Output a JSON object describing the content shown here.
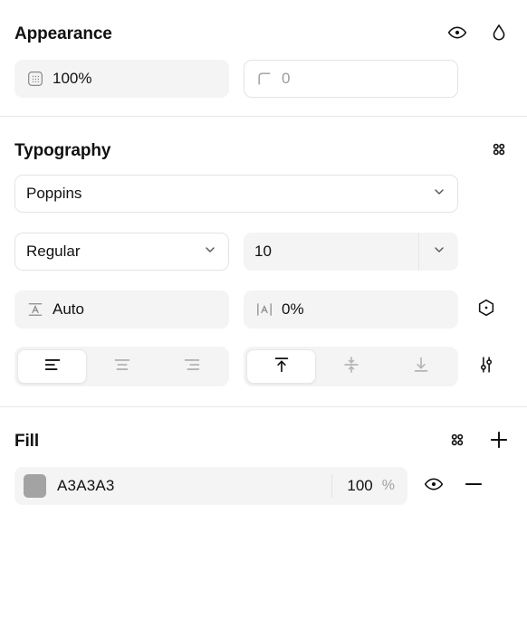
{
  "appearance": {
    "title": "Appearance",
    "actions": [
      {
        "name": "visibility-toggle",
        "icon": "eye-icon"
      },
      {
        "name": "blend-mode",
        "icon": "droplet-icon"
      }
    ],
    "opacity": {
      "icon": "opacity-grid-icon",
      "value": "100%"
    },
    "corner_radius": {
      "icon": "corner-radius-icon",
      "value": "0"
    }
  },
  "typography": {
    "title": "Typography",
    "actions": [
      {
        "name": "typography-styles",
        "icon": "four-dots-icon"
      }
    ],
    "font_family": {
      "value": "Poppins",
      "chevron": "chevron-down-icon"
    },
    "font_weight": {
      "value": "Regular",
      "chevron": "chevron-down-icon"
    },
    "font_size": {
      "value": "10",
      "chevron": "chevron-down-icon"
    },
    "line_height": {
      "icon": "line-height-icon",
      "value": "Auto"
    },
    "letter_spacing": {
      "icon": "letter-spacing-icon",
      "value": "0%"
    },
    "font_variations": {
      "icon": "hexagon-dot-icon"
    },
    "type_settings": {
      "icon": "sliders-icon"
    },
    "horizontal_align": {
      "options": [
        {
          "name": "align-left",
          "icon": "align-left-icon",
          "active": true
        },
        {
          "name": "align-center",
          "icon": "align-center-icon",
          "active": false
        },
        {
          "name": "align-right",
          "icon": "align-right-icon",
          "active": false
        }
      ]
    },
    "vertical_align": {
      "options": [
        {
          "name": "align-top",
          "icon": "align-top-icon",
          "active": true
        },
        {
          "name": "align-middle",
          "icon": "align-middle-icon",
          "active": false
        },
        {
          "name": "align-bottom",
          "icon": "align-bottom-icon",
          "active": false
        }
      ]
    }
  },
  "fill": {
    "title": "Fill",
    "actions": [
      {
        "name": "fill-styles",
        "icon": "four-dots-icon"
      },
      {
        "name": "add-fill",
        "icon": "plus-icon"
      }
    ],
    "items": [
      {
        "swatch_color": "#A3A3A3",
        "hex": "A3A3A3",
        "opacity": "100",
        "opacity_unit": "%",
        "visibility_icon": "eye-icon",
        "remove_icon": "minus-icon"
      }
    ]
  }
}
